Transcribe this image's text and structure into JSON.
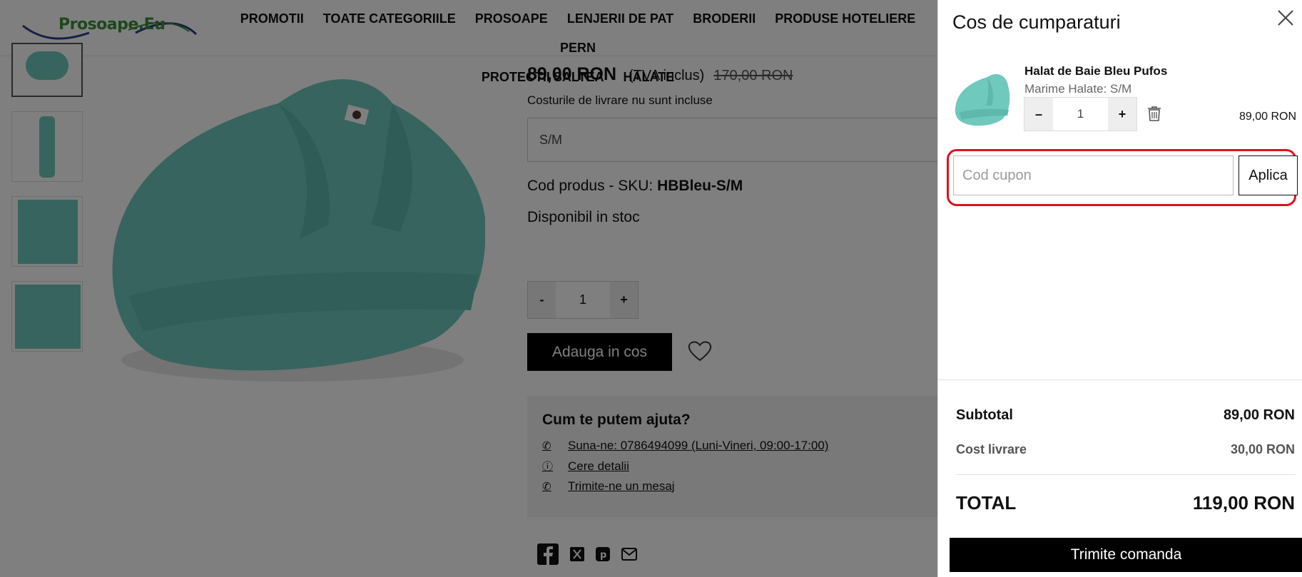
{
  "header": {
    "logo_text": "Prosoape.Eu",
    "nav_items": [
      "PROMOTII",
      "TOATE CATEGORIILE",
      "PROSOAPE",
      "LENJERII DE PAT",
      "BRODERII",
      "PRODUSE HOTELIERE",
      "PERN"
    ],
    "nav_items_row2": [
      "PROTECTII SALTEA",
      "HALATE"
    ]
  },
  "product": {
    "price": "89,00 RON",
    "vat": "(TVA inclus)",
    "old_price": "170,00 RON",
    "shipping_note": "Costurile de livrare nu sunt incluse",
    "size_selected": "S/M",
    "sku_label": "Cod produs - SKU:",
    "sku_value": "HBBleu-S/M",
    "stock": "Disponibil in stoc",
    "qty_minus": "-",
    "qty_value": "1",
    "qty_plus": "+",
    "add_to_cart": "Adauga in cos",
    "help_title": "Cum te putem ajuta?",
    "help_phone": "Suna-ne: 0786494099 (Luni-Vineri, 09:00-17:00)",
    "help_details": "Cere detalii",
    "help_message": "Trimite-ne un mesaj"
  },
  "cart": {
    "title": "Cos de cumparaturi",
    "item_name": "Halat de Baie Bleu Pufos",
    "item_variant": "Marime Halate: S/M",
    "qty_minus": "–",
    "qty_value": "1",
    "qty_plus": "+",
    "item_price": "89,00 RON",
    "coupon_placeholder": "Cod cupon",
    "coupon_button": "Aplica",
    "subtotal_label": "Subtotal",
    "subtotal_value": "89,00 RON",
    "shipping_label": "Cost livrare",
    "shipping_value": "30,00 RON",
    "total_label": "TOTAL",
    "total_value": "119,00 RON",
    "checkout_button": "Trimite comanda"
  },
  "colors": {
    "highlight": "#e0101c",
    "robe": "#6fc9bd",
    "overlay": "rgba(0,0,0,0.5)"
  }
}
